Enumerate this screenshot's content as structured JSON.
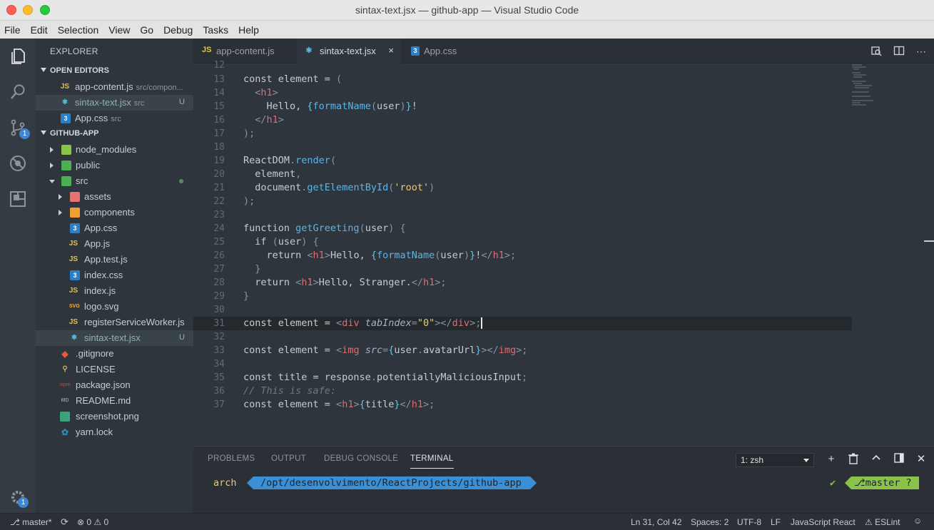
{
  "window": {
    "title": "sintax-text.jsx — github-app — Visual Studio Code"
  },
  "menu": [
    "File",
    "Edit",
    "Selection",
    "View",
    "Go",
    "Debug",
    "Tasks",
    "Help"
  ],
  "activity": {
    "scm_badge": "1",
    "settings_badge": "1"
  },
  "sidebar": {
    "title": "EXPLORER",
    "open_editors_title": "OPEN EDITORS",
    "project_title": "GITHUB-APP",
    "open_editors": [
      {
        "icon": "JS",
        "name": "app-content.js",
        "desc": "src/compon...",
        "status": ""
      },
      {
        "icon": "⚛",
        "name": "sintax-text.jsx",
        "desc": "src",
        "status": "U"
      },
      {
        "icon": "3",
        "name": "App.css",
        "desc": "src",
        "status": ""
      }
    ],
    "tree": [
      {
        "name": "node_modules",
        "status": ""
      },
      {
        "name": "public",
        "status": ""
      },
      {
        "name": "src",
        "status": ""
      },
      {
        "name": "assets",
        "status": ""
      },
      {
        "name": "components",
        "status": ""
      },
      {
        "name": "App.css",
        "status": ""
      },
      {
        "name": "App.js",
        "status": ""
      },
      {
        "name": "App.test.js",
        "status": ""
      },
      {
        "name": "index.css",
        "status": ""
      },
      {
        "name": "index.js",
        "status": ""
      },
      {
        "name": "logo.svg",
        "status": ""
      },
      {
        "name": "registerServiceWorker.js",
        "status": ""
      },
      {
        "name": "sintax-text.jsx",
        "status": "U"
      },
      {
        "name": ".gitignore",
        "status": ""
      },
      {
        "name": "LICENSE",
        "status": ""
      },
      {
        "name": "package.json",
        "status": ""
      },
      {
        "name": "README.md",
        "status": ""
      },
      {
        "name": "screenshot.png",
        "status": ""
      },
      {
        "name": "yarn.lock",
        "status": ""
      }
    ]
  },
  "tabs": [
    {
      "icon": "JS",
      "label": "app-content.js"
    },
    {
      "icon": "⚛",
      "label": "sintax-text.jsx",
      "close": "×"
    },
    {
      "icon": "3",
      "label": "App.css"
    }
  ],
  "editor": {
    "line_numbers": [
      "12",
      "13",
      "14",
      "15",
      "16",
      "17",
      "18",
      "19",
      "20",
      "21",
      "22",
      "23",
      "24",
      "25",
      "26",
      "27",
      "28",
      "29",
      "30",
      "31",
      "32",
      "33",
      "34",
      "35",
      "36",
      "37"
    ]
  },
  "panel": {
    "tabs": [
      "PROBLEMS",
      "OUTPUT",
      "DEBUG CONSOLE",
      "TERMINAL"
    ],
    "terminal_select": "1: zsh",
    "prompt_user": "arch",
    "prompt_path": "/opt/desenvolvimento/ReactProjects/github-app",
    "prompt_check": "✔",
    "prompt_branch": "master ?"
  },
  "status": {
    "branch": "master*",
    "errors": "0",
    "warnings": "0",
    "position": "Ln 31, Col 42",
    "spaces": "Spaces: 2",
    "encoding": "UTF-8",
    "eol": "LF",
    "language": "JavaScript React",
    "linter": "ESLint"
  }
}
